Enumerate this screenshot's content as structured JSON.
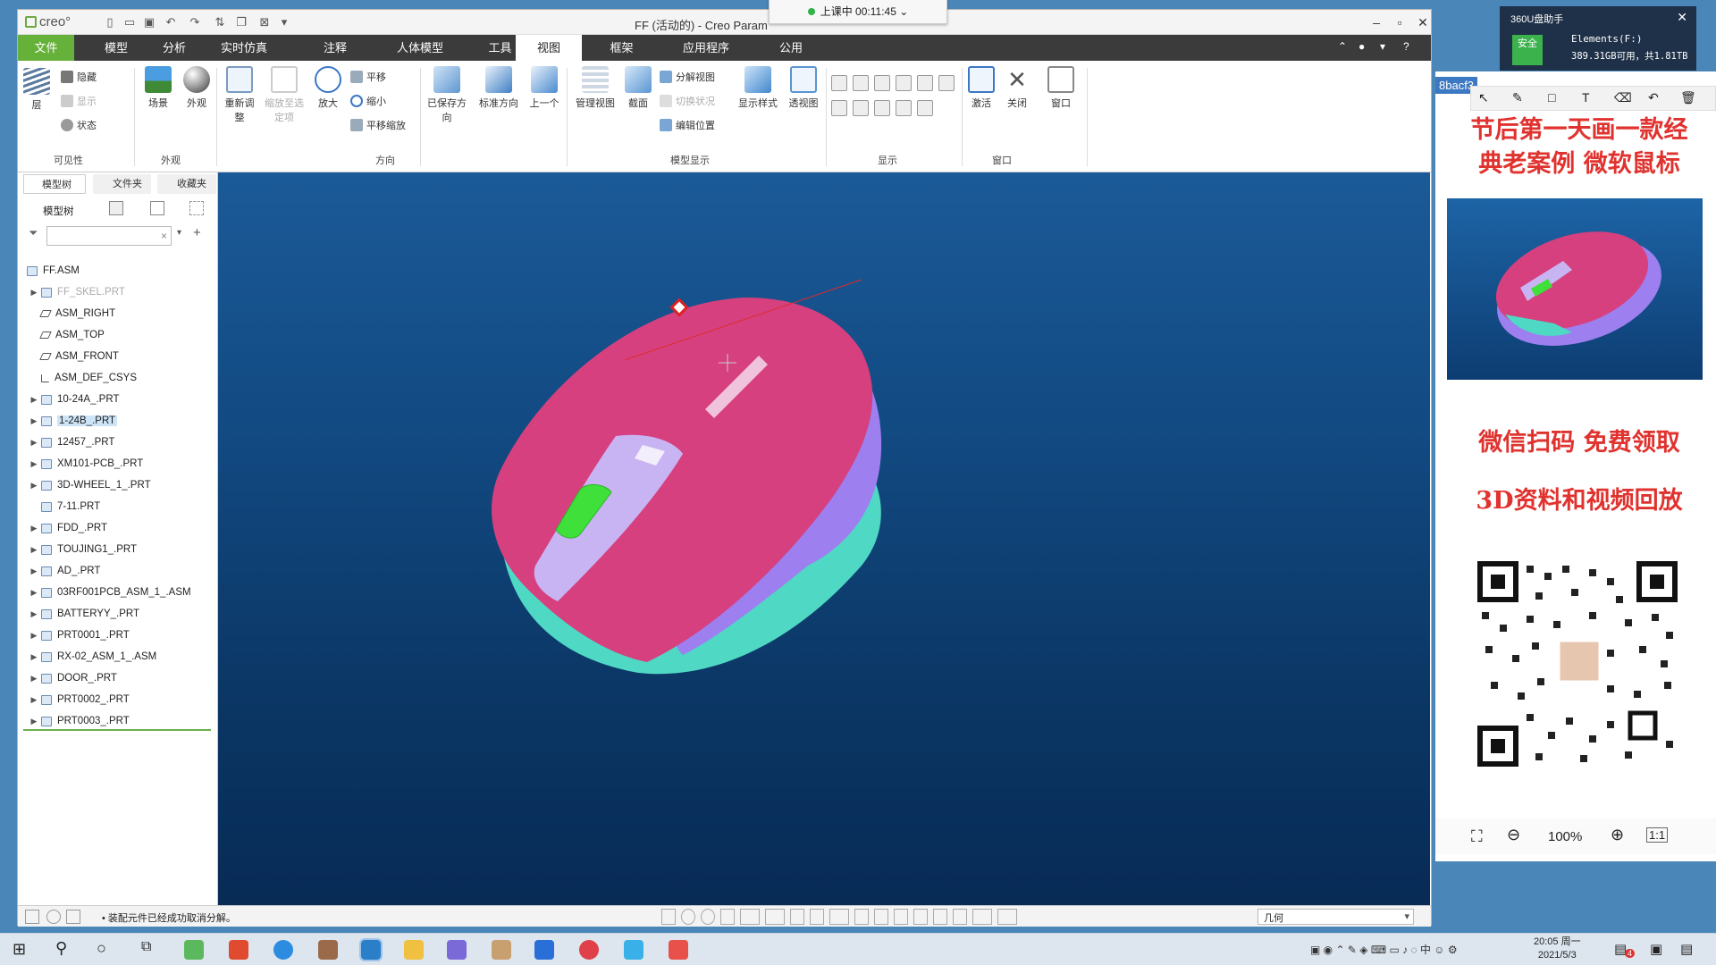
{
  "window": {
    "title": "FF (活动的) - Creo Param",
    "app_logo": "creo°"
  },
  "timer": {
    "label": "上课中 00:11:45",
    "chevron": "⌄"
  },
  "menu": {
    "tabs": [
      "文件",
      "模型",
      "分析",
      "实时仿真",
      "注释",
      "人体模型",
      "工具",
      "视图",
      "框架",
      "应用程序",
      "公用"
    ],
    "active": "视图"
  },
  "ribbon": {
    "visibility": {
      "layer": "层",
      "hide": "隐藏",
      "show": "显示",
      "status": "状态",
      "group": "可见性"
    },
    "appearance": {
      "scene": "场景",
      "appearance": "外观",
      "group": "外观"
    },
    "orientation": {
      "refit": "重新调整",
      "zoom_to_selected": "缩放至选定项",
      "zoom_in": "放大",
      "pan": "平移",
      "zoom_out": "缩小",
      "pan_zoom": "平移缩放",
      "saved_orientations": "已保存方向",
      "standard_orientation": "标准方向",
      "previous": "上一个",
      "group": "方向"
    },
    "model_display": {
      "manage_views": "管理视图",
      "section": "截面",
      "explode_view": "分解视图",
      "toggle_status": "切换状况",
      "edit_position": "编辑位置",
      "display_style": "显示样式",
      "perspective": "透视图",
      "group": "模型显示"
    },
    "show": {
      "group": "显示"
    },
    "window": {
      "activate": "激活",
      "close": "关闭",
      "window": "窗口",
      "group": "窗口"
    }
  },
  "left_panel": {
    "tabs": [
      "模型树",
      "文件夹",
      "收藏夹"
    ],
    "header": "模型树",
    "tree": [
      {
        "label": "FF.ASM",
        "type": "asm"
      },
      {
        "label": "FF_SKEL.PRT",
        "type": "part",
        "dimmed": true,
        "expandable": true
      },
      {
        "label": "ASM_RIGHT",
        "type": "plane"
      },
      {
        "label": "ASM_TOP",
        "type": "plane"
      },
      {
        "label": "ASM_FRONT",
        "type": "plane"
      },
      {
        "label": "ASM_DEF_CSYS",
        "type": "csys"
      },
      {
        "label": "10-24A_.PRT",
        "type": "part",
        "expandable": true
      },
      {
        "label": "1-24B_.PRT",
        "type": "part",
        "expandable": true,
        "selected": true
      },
      {
        "label": "12457_.PRT",
        "type": "part",
        "expandable": true
      },
      {
        "label": "XM101-PCB_.PRT",
        "type": "part",
        "expandable": true
      },
      {
        "label": "3D-WHEEL_1_.PRT",
        "type": "part",
        "expandable": true
      },
      {
        "label": "7-11.PRT",
        "type": "part"
      },
      {
        "label": "FDD_.PRT",
        "type": "part",
        "expandable": true
      },
      {
        "label": "TOUJING1_.PRT",
        "type": "part",
        "expandable": true
      },
      {
        "label": "AD_.PRT",
        "type": "part",
        "expandable": true
      },
      {
        "label": "03RF001PCB_ASM_1_.ASM",
        "type": "asm",
        "expandable": true
      },
      {
        "label": "BATTERYY_.PRT",
        "type": "part",
        "expandable": true
      },
      {
        "label": "PRT0001_.PRT",
        "type": "part",
        "expandable": true
      },
      {
        "label": "RX-02_ASM_1_.ASM",
        "type": "asm",
        "expandable": true
      },
      {
        "label": "DOOR_.PRT",
        "type": "part",
        "expandable": true
      },
      {
        "label": "PRT0002_.PRT",
        "type": "part",
        "expandable": true
      },
      {
        "label": "PRT0003_.PRT",
        "type": "part",
        "expandable": true
      }
    ]
  },
  "status": {
    "message": "装配元件已经成功取消分解。",
    "filter_value": "几何"
  },
  "ad": {
    "heading_line1": "节后第一天画一款经",
    "heading_line2": "典老案例 微软鼠标",
    "line3": "微信扫码 免费领取",
    "line4": "3D资料和视频回放",
    "zoom": "100%",
    "url_fragment": "8bacf3"
  },
  "popup360": {
    "title": "360U盘助手",
    "badge": "安全",
    "drive": "Elements(F:)",
    "space": "389.31GB可用，共1.81TB"
  },
  "taskbar": {
    "time": "20:05 周一",
    "date": "2021/5/3",
    "notif_count": "4"
  },
  "colors": {
    "menu_bg": "#3b3b3b",
    "file_tab": "#66b13a",
    "viewport_top": "#1b5a98",
    "viewport_bottom": "#072b55",
    "mouse_body": "#d6407e",
    "mouse_side": "#9a7ee6",
    "button_green": "#3fe03a",
    "ad_red": "#e0322e"
  }
}
